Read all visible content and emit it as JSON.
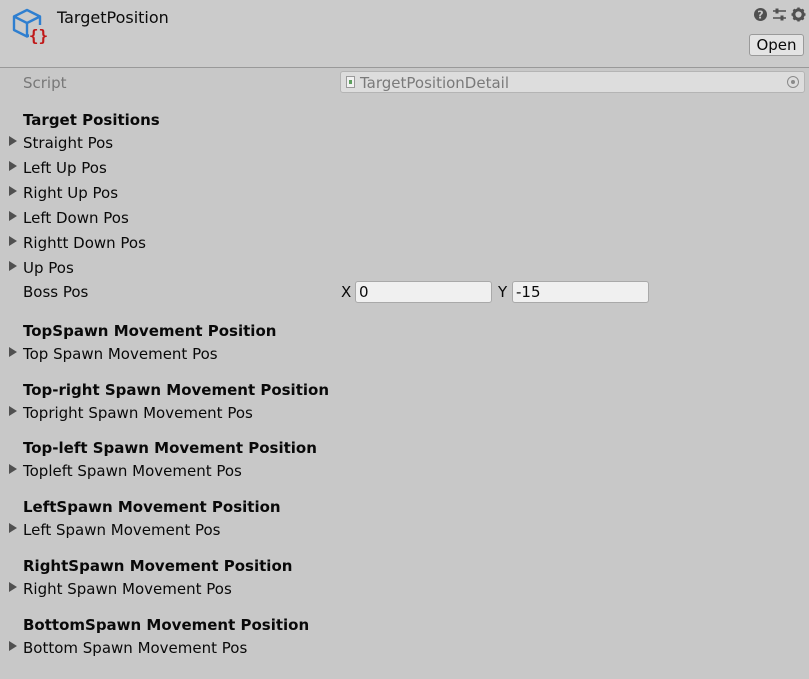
{
  "header": {
    "title": "TargetPosition",
    "open_label": "Open",
    "icons": [
      "script-object-icon",
      "help-icon",
      "preset-icon",
      "settings-icon"
    ]
  },
  "script": {
    "label": "Script",
    "value": "TargetPositionDetail"
  },
  "sections": [
    {
      "header": "Target Positions",
      "items": [
        "Straight Pos",
        "Left Up Pos",
        "Right Up Pos",
        "Left Down Pos",
        "Rightt Down Pos",
        "Up Pos"
      ]
    },
    {
      "header": "TopSpawn Movement Position",
      "items": [
        "Top Spawn Movement Pos"
      ]
    },
    {
      "header": "Top-right Spawn Movement Position",
      "items": [
        "Topright Spawn Movement Pos"
      ]
    },
    {
      "header": "Top-left Spawn Movement Position",
      "items": [
        "Topleft Spawn Movement Pos"
      ]
    },
    {
      "header": "LeftSpawn Movement Position",
      "items": [
        "Left Spawn Movement Pos"
      ]
    },
    {
      "header": "RightSpawn Movement Position",
      "items": [
        "Right Spawn Movement Pos"
      ]
    },
    {
      "header": "BottomSpawn Movement Position",
      "items": [
        "Bottom Spawn Movement Pos"
      ]
    }
  ],
  "boss_pos": {
    "label": "Boss Pos",
    "x_label": "X",
    "x_value": "0",
    "y_label": "Y",
    "y_value": "-15"
  },
  "colors": {
    "background": "#c8c8c8",
    "icon_blue": "#2f7fd0",
    "icon_red": "#c01818"
  }
}
